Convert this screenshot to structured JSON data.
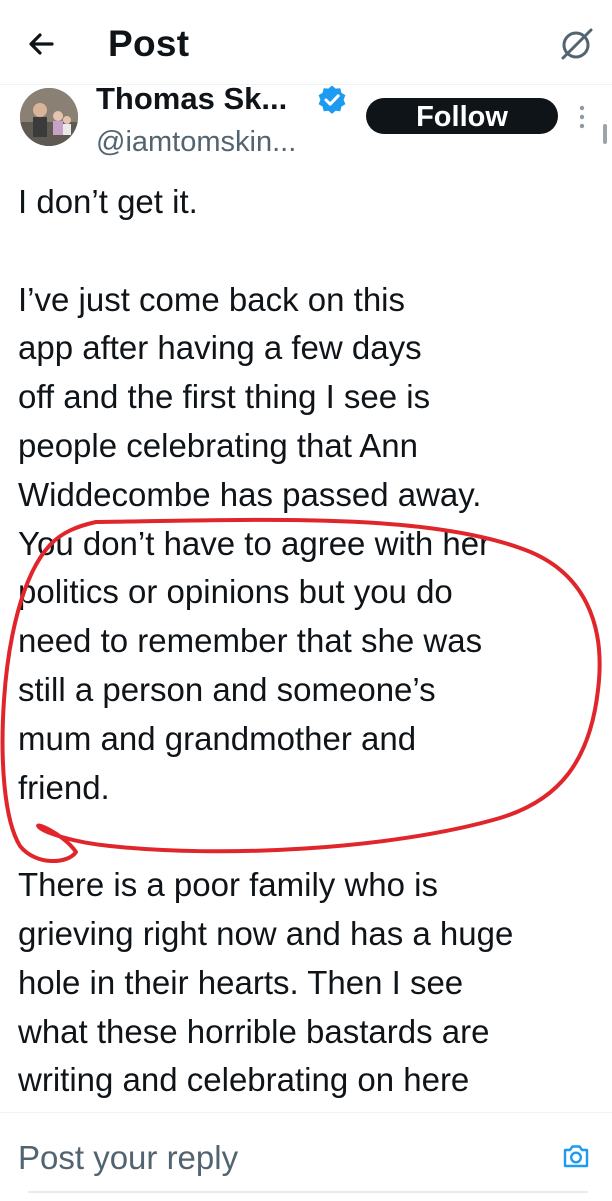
{
  "header": {
    "title": "Post",
    "back_icon": "back-arrow-icon",
    "grok_icon": "grok-icon"
  },
  "post": {
    "author_name": "Thomas Sk...",
    "author_handle": "@iamtomskin...",
    "verified": true,
    "follow_label": "Follow",
    "more_icon": "more-vertical-icon",
    "lines": [
      "I don’t get it.",
      "",
      "I’ve just come back on this",
      "app after having a few days",
      "off and the first thing I see is",
      "people celebrating that Ann",
      "Widdecombe has passed away.",
      "You don’t have to agree with her",
      "politics or opinions but you do",
      "need to remember that she was",
      "still a person and someone’s",
      "mum and grandmother and",
      "friend.",
      "",
      "There is a poor family who is",
      "grieving right now and has a huge",
      "hole in their hearts. Then I see",
      "what these horrible bastards are",
      "writing and celebrating on here"
    ]
  },
  "reply": {
    "placeholder": "Post your reply",
    "camera_icon": "camera-icon"
  },
  "colors": {
    "text": "#0f1419",
    "secondary_text": "#536471",
    "verified_blue": "#1d9bf0",
    "follow_bg": "#0f1419",
    "annotation_red": "#e0262b",
    "reply_icon": "#1d9bf0"
  }
}
